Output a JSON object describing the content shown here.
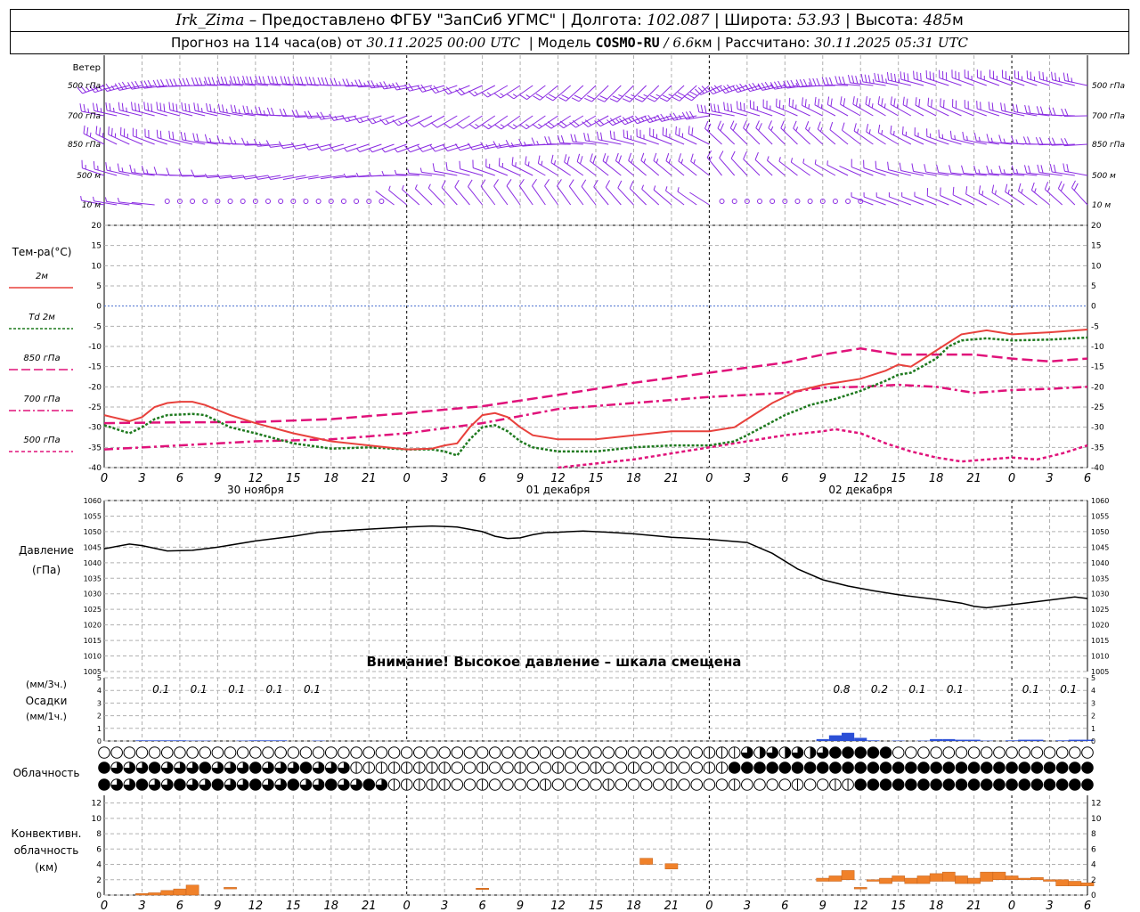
{
  "header": {
    "station": "Irk_Zima",
    "provider": "– Предоставлено ФГБУ \"ЗапСиб УГМС\"",
    "lon_label": "Долгота:",
    "lon": "102.087",
    "lat_label": "Широта:",
    "lat": "53.93",
    "alt_label": "Высота:",
    "alt": "485",
    "alt_unit": "м",
    "forecast_label": "Прогноз на 114 часа(ов) от",
    "forecast_start": "30.11.2025 00:00 UTC",
    "model_label": "Модель",
    "model": "COSMO-RU",
    "model_res": "/ 6.6",
    "model_res_unit": "км",
    "computed_label": "Рассчитано:",
    "computed": "30.11.2025 05:31 UTC"
  },
  "colors": {
    "wind": "#8a2be2",
    "t2m": "#e8413c",
    "td2m": "#1f7a1f",
    "t850": "#e0127a",
    "t700": "#e0127a",
    "t500": "#e0127a",
    "zero_line": "#4a6fd0",
    "pressure": "#000000",
    "precip": "#2b4fd6",
    "conv": "#f0812a",
    "grid": "#b0b0b0"
  },
  "wind_panel": {
    "title": "Ветер",
    "levels": [
      "500 гПа",
      "700 гПа",
      "850 гПа",
      "500 м",
      "10 м"
    ]
  },
  "temp_panel": {
    "title": "Тем-ра(°С)",
    "legend": [
      {
        "label": "2м",
        "style": "solid"
      },
      {
        "label": "Td 2м",
        "style": "dotted"
      },
      {
        "label": "850 гПа",
        "style": "long-dash"
      },
      {
        "label": "700 гПа",
        "style": "dash-dot"
      },
      {
        "label": "500 гПа",
        "style": "short-dash"
      }
    ],
    "yticks": [
      "20",
      "15",
      "10",
      "5",
      "0",
      "-5",
      "-10",
      "-15",
      "-20",
      "-25",
      "-30",
      "-35",
      "-40"
    ]
  },
  "time_axis": {
    "hours": [
      "0",
      "3",
      "6",
      "9",
      "12",
      "15",
      "18",
      "21",
      "0",
      "3",
      "6",
      "9",
      "12",
      "15",
      "18",
      "21",
      "0",
      "3",
      "6",
      "9",
      "12",
      "15",
      "18",
      "21",
      "0",
      "3",
      "6"
    ],
    "dates": [
      "30 ноября",
      "01 декабря",
      "02 декабря"
    ]
  },
  "pressure_panel": {
    "title": "Давление",
    "unit": "(гПа)",
    "yticks": [
      "1060",
      "1055",
      "1050",
      "1045",
      "1040",
      "1035",
      "1030",
      "1025",
      "1020",
      "1015",
      "1010",
      "1005"
    ],
    "warning": "Внимание! Высокое давление – шкала смещена"
  },
  "precip_panel": {
    "unit1": "(мм/3ч.)",
    "title": "Осадки",
    "unit2": "(мм/1ч.)",
    "yticks": [
      "5",
      "4",
      "3",
      "2",
      "1",
      "0"
    ],
    "totals": [
      {
        "hour": 4.5,
        "text": "0.1"
      },
      {
        "hour": 7.5,
        "text": "0.1"
      },
      {
        "hour": 10.5,
        "text": "0.1"
      },
      {
        "hour": 13.5,
        "text": "0.1"
      },
      {
        "hour": 16.5,
        "text": "0.1"
      },
      {
        "hour": 58.5,
        "text": "0.8"
      },
      {
        "hour": 61.5,
        "text": "0.2"
      },
      {
        "hour": 64.5,
        "text": "0.1"
      },
      {
        "hour": 67.5,
        "text": "0.1"
      },
      {
        "hour": 73.5,
        "text": "0.1"
      },
      {
        "hour": 76.5,
        "text": "0.1"
      }
    ]
  },
  "cloud_panel": {
    "title": "Облачность"
  },
  "conv_panel": {
    "title1": "Конвективн.",
    "title2": "облачность",
    "unit": "(км)",
    "yticks": [
      "12",
      "10",
      "8",
      "6",
      "4",
      "2",
      "0"
    ]
  },
  "chart_data": {
    "type": "line",
    "x_unit": "hours since 30.11.2025 00:00 UTC",
    "xlim": [
      0,
      78
    ],
    "t2m": [
      [
        0,
        -27
      ],
      [
        2,
        -28.5
      ],
      [
        3,
        -27.5
      ],
      [
        4,
        -25
      ],
      [
        5,
        -24
      ],
      [
        6,
        -23.7
      ],
      [
        7,
        -23.7
      ],
      [
        8,
        -24.5
      ],
      [
        10,
        -27
      ],
      [
        12,
        -29
      ],
      [
        15,
        -31.5
      ],
      [
        18,
        -33.5
      ],
      [
        21,
        -34.5
      ],
      [
        24,
        -35.5
      ],
      [
        26,
        -35.3
      ],
      [
        27,
        -34.5
      ],
      [
        28,
        -34
      ],
      [
        29,
        -30
      ],
      [
        30,
        -27
      ],
      [
        31,
        -26.5
      ],
      [
        32,
        -27.5
      ],
      [
        33,
        -30
      ],
      [
        34,
        -32
      ],
      [
        36,
        -33
      ],
      [
        39,
        -33
      ],
      [
        42,
        -32
      ],
      [
        45,
        -31
      ],
      [
        48,
        -31
      ],
      [
        50,
        -30
      ],
      [
        51,
        -28
      ],
      [
        53,
        -24
      ],
      [
        55,
        -21
      ],
      [
        57,
        -19.5
      ],
      [
        60,
        -18
      ],
      [
        62,
        -16
      ],
      [
        63,
        -14.5
      ],
      [
        64,
        -15
      ],
      [
        65,
        -13
      ],
      [
        67,
        -9
      ],
      [
        68,
        -7
      ],
      [
        70,
        -6
      ],
      [
        72,
        -7
      ],
      [
        75,
        -6.5
      ],
      [
        78,
        -5.8
      ]
    ],
    "td2m": [
      [
        0,
        -29.5
      ],
      [
        2,
        -31.5
      ],
      [
        3,
        -30
      ],
      [
        4,
        -28
      ],
      [
        5,
        -27
      ],
      [
        7,
        -26.7
      ],
      [
        8,
        -27
      ],
      [
        10,
        -30
      ],
      [
        12,
        -31.5
      ],
      [
        15,
        -34
      ],
      [
        18,
        -35.3
      ],
      [
        21,
        -35
      ],
      [
        24,
        -35.5
      ],
      [
        26,
        -35.5
      ],
      [
        27,
        -36
      ],
      [
        28,
        -37
      ],
      [
        29,
        -33
      ],
      [
        30,
        -30
      ],
      [
        31,
        -29.5
      ],
      [
        32,
        -31
      ],
      [
        33,
        -33.5
      ],
      [
        34,
        -35
      ],
      [
        36,
        -36
      ],
      [
        39,
        -36
      ],
      [
        42,
        -35
      ],
      [
        45,
        -34.5
      ],
      [
        48,
        -34.5
      ],
      [
        50,
        -33.5
      ],
      [
        51,
        -32
      ],
      [
        54,
        -27
      ],
      [
        56,
        -24.5
      ],
      [
        58,
        -23
      ],
      [
        60,
        -21
      ],
      [
        62,
        -18.5
      ],
      [
        63,
        -17
      ],
      [
        64,
        -16.5
      ],
      [
        66,
        -13
      ],
      [
        67,
        -10
      ],
      [
        68,
        -8.5
      ],
      [
        70,
        -8
      ],
      [
        72,
        -8.5
      ],
      [
        75,
        -8.3
      ],
      [
        78,
        -7.8
      ]
    ],
    "t850": [
      [
        0,
        -29
      ],
      [
        6,
        -28.8
      ],
      [
        12,
        -28.7
      ],
      [
        18,
        -28
      ],
      [
        24,
        -26.5
      ],
      [
        30,
        -24.8
      ],
      [
        36,
        -22
      ],
      [
        42,
        -19
      ],
      [
        48,
        -16.5
      ],
      [
        54,
        -14
      ],
      [
        57,
        -12
      ],
      [
        60,
        -10.5
      ],
      [
        63,
        -12
      ],
      [
        66,
        -12
      ],
      [
        69,
        -12
      ],
      [
        72,
        -13
      ],
      [
        75,
        -13.7
      ],
      [
        78,
        -13
      ]
    ],
    "t700": [
      [
        0,
        -35.5
      ],
      [
        6,
        -34.5
      ],
      [
        12,
        -33.5
      ],
      [
        18,
        -33
      ],
      [
        24,
        -31.5
      ],
      [
        30,
        -29
      ],
      [
        36,
        -25.5
      ],
      [
        42,
        -24
      ],
      [
        48,
        -22.5
      ],
      [
        51,
        -22
      ],
      [
        54,
        -21.5
      ],
      [
        57,
        -20.2
      ],
      [
        60,
        -20
      ],
      [
        63,
        -19.5
      ],
      [
        66,
        -20
      ],
      [
        69,
        -21.5
      ],
      [
        72,
        -20.8
      ],
      [
        75,
        -20.5
      ],
      [
        78,
        -20
      ]
    ],
    "t500": [
      [
        36,
        -40
      ],
      [
        42,
        -38
      ],
      [
        48,
        -35
      ],
      [
        54,
        -32
      ],
      [
        57,
        -31
      ],
      [
        58,
        -30.5
      ],
      [
        60,
        -31.5
      ],
      [
        62,
        -34
      ],
      [
        64,
        -36
      ],
      [
        66,
        -37.5
      ],
      [
        68,
        -38.5
      ],
      [
        70,
        -38
      ],
      [
        72,
        -37.5
      ],
      [
        74,
        -38
      ],
      [
        76,
        -36.5
      ],
      [
        78,
        -34.5
      ]
    ],
    "pressure_ylim": [
      1005,
      1060
    ],
    "pressure": [
      [
        0,
        1044.5
      ],
      [
        2,
        1046
      ],
      [
        3,
        1045.5
      ],
      [
        5,
        1043.8
      ],
      [
        7,
        1044
      ],
      [
        9,
        1045
      ],
      [
        12,
        1047
      ],
      [
        15,
        1048.5
      ],
      [
        17,
        1049.8
      ],
      [
        21,
        1050.8
      ],
      [
        24,
        1051.5
      ],
      [
        26,
        1051.8
      ],
      [
        28,
        1051.5
      ],
      [
        30,
        1050
      ],
      [
        31,
        1048.5
      ],
      [
        32,
        1047.8
      ],
      [
        33,
        1048
      ],
      [
        34,
        1049
      ],
      [
        35,
        1049.7
      ],
      [
        36,
        1049.8
      ],
      [
        38,
        1050.2
      ],
      [
        40,
        1049.8
      ],
      [
        42,
        1049.3
      ],
      [
        45,
        1048.2
      ],
      [
        48,
        1047.5
      ],
      [
        51,
        1046.5
      ],
      [
        53,
        1043
      ],
      [
        55,
        1038
      ],
      [
        57,
        1034.5
      ],
      [
        59,
        1032.5
      ],
      [
        61,
        1031
      ],
      [
        63,
        1029.7
      ],
      [
        66,
        1028.2
      ],
      [
        68,
        1027
      ],
      [
        69,
        1026
      ],
      [
        70,
        1025.5
      ],
      [
        72,
        1026.5
      ],
      [
        74,
        1027.5
      ],
      [
        76,
        1028.5
      ],
      [
        77,
        1029
      ],
      [
        78,
        1028.5
      ]
    ],
    "precip_ylim": [
      0,
      5
    ],
    "precip_1h": [
      [
        3,
        0.05
      ],
      [
        4,
        0.05
      ],
      [
        5,
        0.05
      ],
      [
        6,
        0.05
      ],
      [
        7,
        0.03
      ],
      [
        8,
        0.03
      ],
      [
        11,
        0.03
      ],
      [
        12,
        0.05
      ],
      [
        13,
        0.05
      ],
      [
        14,
        0.05
      ],
      [
        17,
        0.03
      ],
      [
        57,
        0.15
      ],
      [
        58,
        0.45
      ],
      [
        59,
        0.65
      ],
      [
        60,
        0.25
      ],
      [
        61,
        0.05
      ],
      [
        63,
        0.03
      ],
      [
        65,
        0.03
      ],
      [
        66,
        0.15
      ],
      [
        67,
        0.15
      ],
      [
        68,
        0.1
      ],
      [
        69,
        0.1
      ],
      [
        70,
        0.03
      ],
      [
        72,
        0.05
      ],
      [
        73,
        0.1
      ],
      [
        74,
        0.1
      ],
      [
        76,
        0.05
      ],
      [
        77,
        0.1
      ],
      [
        78,
        0.1
      ]
    ],
    "cloud_ylim": [
      0,
      13
    ],
    "conv_base_top_km": [
      [
        3,
        0,
        0.2
      ],
      [
        4,
        0,
        0.3
      ],
      [
        5,
        0,
        0.6
      ],
      [
        6,
        0,
        0.8
      ],
      [
        7,
        0,
        1.3
      ],
      [
        10,
        0.8,
        1.0
      ],
      [
        30,
        0.8,
        0.9
      ],
      [
        43,
        4.0,
        4.8
      ],
      [
        45,
        3.4,
        4.1
      ],
      [
        57,
        1.8,
        2.2
      ],
      [
        58,
        1.8,
        2.5
      ],
      [
        59,
        2.0,
        3.2
      ],
      [
        60,
        0.8,
        1.0
      ],
      [
        61,
        1.8,
        2.0
      ],
      [
        62,
        1.5,
        2.2
      ],
      [
        63,
        1.8,
        2.5
      ],
      [
        64,
        1.5,
        2.2
      ],
      [
        65,
        1.5,
        2.5
      ],
      [
        66,
        1.8,
        2.8
      ],
      [
        67,
        1.8,
        3.0
      ],
      [
        68,
        1.5,
        2.5
      ],
      [
        69,
        1.5,
        2.2
      ],
      [
        70,
        1.8,
        3.0
      ],
      [
        71,
        2.0,
        3.0
      ],
      [
        72,
        2.0,
        2.5
      ],
      [
        73,
        2.0,
        2.2
      ],
      [
        74,
        2.0,
        2.3
      ],
      [
        75,
        1.8,
        2.0
      ],
      [
        76,
        1.2,
        2.0
      ],
      [
        77,
        1.2,
        1.8
      ],
      [
        78,
        1.2,
        1.6
      ]
    ]
  }
}
